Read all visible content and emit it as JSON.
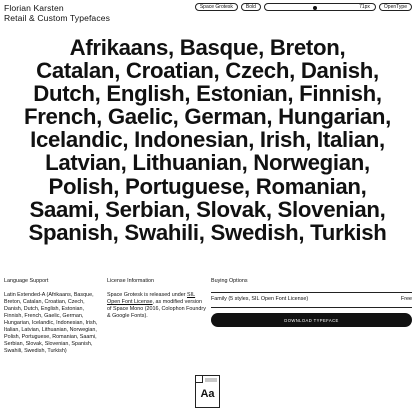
{
  "header": {
    "name": "Florian Karsten",
    "tagline": "Retail & Custom Typefaces"
  },
  "toolbar": {
    "font_select": "Space Grotesk",
    "style_select": "Bold",
    "size_value": "71px",
    "size_level_fraction": 0.45,
    "opentype_button": "OpenType"
  },
  "specimen": {
    "lines": [
      "Afrikaans, Basque, Breton,",
      "Catalan, Croatian, Czech, Danish,",
      "Dutch, English, Estonian, Finnish,",
      "French, Gaelic, German, Hungarian,",
      "Icelandic, Indonesian, Irish, Italian,",
      "Latvian, Lithuanian, Norwegian,",
      "Polish, Portuguese, Romanian,",
      "Saami, Serbian, Slovak, Slovenian,",
      "Spanish, Swahili, Swedish, Turkish"
    ]
  },
  "language_support": {
    "heading": "Language Support",
    "body": "Latin Extended-A (Afrikaans, Basque, Breton, Catalan, Croatian, Czech, Danish, Dutch, English, Estonian, Finnish, French, Gaelic, German, Hungarian, Icelandic, Indonesian, Irish, Italian, Latvian, Lithuanian, Norwegian, Polish, Portuguese, Romanian, Saami, Serbian, Slovak, Slovenian, Spanish, Swahili, Swedish, Turkish)"
  },
  "license": {
    "heading": "License Information",
    "body_before": "Space Grotesk is released under ",
    "link": "SIL Open Font License",
    "body_after": ", as modified version of Space Mono (2016, Colophon Foundry & Google Fonts)."
  },
  "buying": {
    "heading": "Buying Options",
    "family_label": "Family (5 styles, SIL Open Font License)",
    "price": "Free",
    "download_button": "DOWNLOAD TYPEFACE"
  },
  "file_icon": {
    "icon": "font-file-icon",
    "glyph": "Aa"
  }
}
